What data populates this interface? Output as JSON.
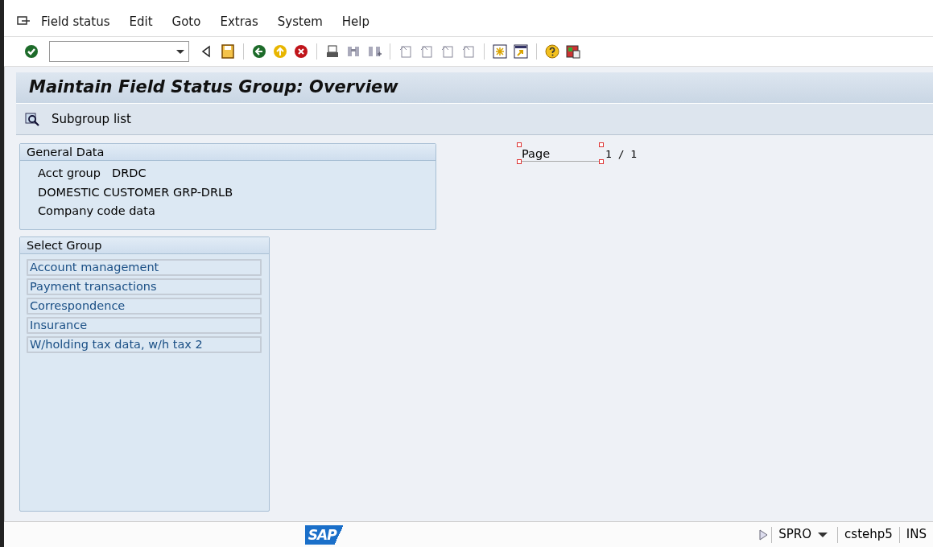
{
  "menu": [
    "Field status",
    "Edit",
    "Goto",
    "Extras",
    "System",
    "Help"
  ],
  "title": "Maintain Field Status Group: Overview",
  "app_toolbar": [
    {
      "label": "Subgroup list"
    }
  ],
  "general_data": {
    "title": "General Data",
    "lines": [
      {
        "label": "Acct group",
        "value": "DRDC"
      },
      {
        "label": "DOMESTIC CUSTOMER GRP-DRLB"
      },
      {
        "label": "Company code data"
      }
    ]
  },
  "page": {
    "label": "Page",
    "value": "1 / 1"
  },
  "select_group": {
    "title": "Select Group",
    "items": [
      "Account management",
      "Payment transactions",
      "Correspondence",
      "Insurance",
      "W/holding tax data, w/h tax 2"
    ]
  },
  "status_bar": {
    "logo": "SAP",
    "transaction": "SPRO",
    "server": "cstehp5",
    "mode": "INS"
  }
}
